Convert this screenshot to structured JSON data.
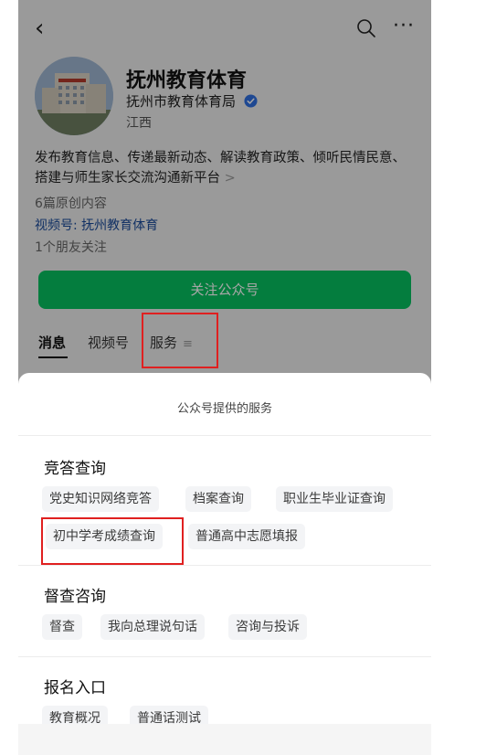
{
  "header": {
    "back_icon": "chevron-left-icon",
    "search_icon": "search-icon",
    "more_icon": "more-horizontal-icon"
  },
  "account": {
    "name": "抚州教育体育",
    "org": "抚州市教育体育局",
    "location": "江西",
    "intro": "发布教育信息、传递最新动态、解读教育政策、倾听民情民意、搭建与师生家长交流沟通新平台",
    "intro_arrow": ">",
    "original_count": "6篇原创内容",
    "channel": "视频号: 抚州教育体育",
    "friends": "1个朋友关注",
    "follow_label": "关注公众号"
  },
  "tabs": {
    "messages": "消息",
    "videos": "视频号",
    "services": "服务",
    "services_icon": "≡"
  },
  "sheet": {
    "title": "公众号提供的服务",
    "sections": [
      {
        "title": "竞答查询",
        "items": [
          "党史知识网络竞答",
          "档案查询",
          "职业生毕业证查询",
          "初中学考成绩查询",
          "普通高中志愿填报"
        ]
      },
      {
        "title": "督查咨询",
        "items": [
          "督查",
          "我向总理说句话",
          "咨询与投诉"
        ]
      },
      {
        "title": "报名入口",
        "items": [
          "教育概况",
          "普通话测试"
        ]
      }
    ]
  },
  "colors": {
    "follow_button": "#07c160",
    "highlight": "#e02020",
    "channel_link": "#1a4a9a"
  }
}
